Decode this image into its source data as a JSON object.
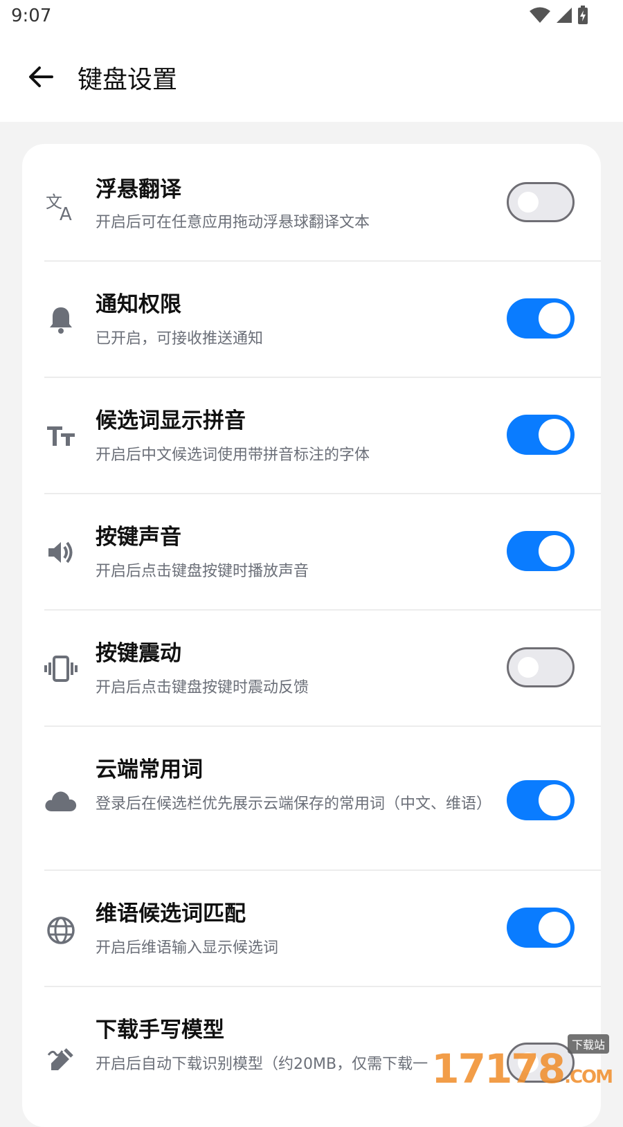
{
  "status": {
    "time": "9:07"
  },
  "header": {
    "title": "键盘设置"
  },
  "colors": {
    "accent": "#0a7cff",
    "off_border": "#6f6e74",
    "desc": "#6b6f78"
  },
  "settings": [
    {
      "icon": "translate-icon",
      "title": "浮悬翻译",
      "desc": "开启后可在任意应用拖动浮悬球翻译文本",
      "enabled": false
    },
    {
      "icon": "bell-icon",
      "title": "通知权限",
      "desc": "已开启，可接收推送通知",
      "enabled": true
    },
    {
      "icon": "text-size-icon",
      "title": "候选词显示拼音",
      "desc": "开启后中文候选词使用带拼音标注的字体",
      "enabled": true
    },
    {
      "icon": "speaker-icon",
      "title": "按键声音",
      "desc": "开启后点击键盘按键时播放声音",
      "enabled": true
    },
    {
      "icon": "vibrate-icon",
      "title": "按键震动",
      "desc": "开启后点击键盘按键时震动反馈",
      "enabled": false
    },
    {
      "icon": "cloud-icon",
      "title": "云端常用词",
      "desc": "登录后在候选栏优先展示云端保存的常用词（中文、维语）",
      "enabled": true
    },
    {
      "icon": "globe-icon",
      "title": "维语候选词匹配",
      "desc": "开启后维语输入显示候选词",
      "enabled": true
    },
    {
      "icon": "handwriting-icon",
      "title": "下载手写模型",
      "desc": "开启后自动下载识别模型（约20MB，仅需下载一",
      "enabled": false
    }
  ],
  "watermark": {
    "text": "17178",
    "tag": "下载站",
    "suffix": ".COM"
  }
}
